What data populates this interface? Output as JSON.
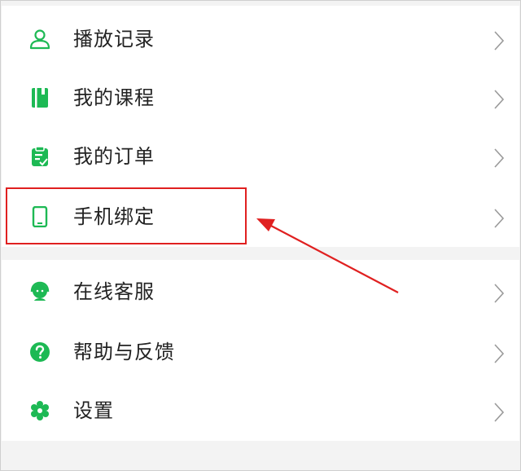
{
  "menu": {
    "items": [
      {
        "label": "播放记录",
        "icon": "user-icon"
      },
      {
        "label": "我的课程",
        "icon": "book-icon"
      },
      {
        "label": "我的订单",
        "icon": "clipboard-icon"
      },
      {
        "label": "手机绑定",
        "icon": "phone-icon"
      },
      {
        "label": "在线客服",
        "icon": "headset-icon"
      },
      {
        "label": "帮助与反馈",
        "icon": "help-icon"
      },
      {
        "label": "设置",
        "icon": "gear-icon"
      }
    ]
  },
  "colors": {
    "accent": "#1db954",
    "annotation": "#e02020"
  }
}
